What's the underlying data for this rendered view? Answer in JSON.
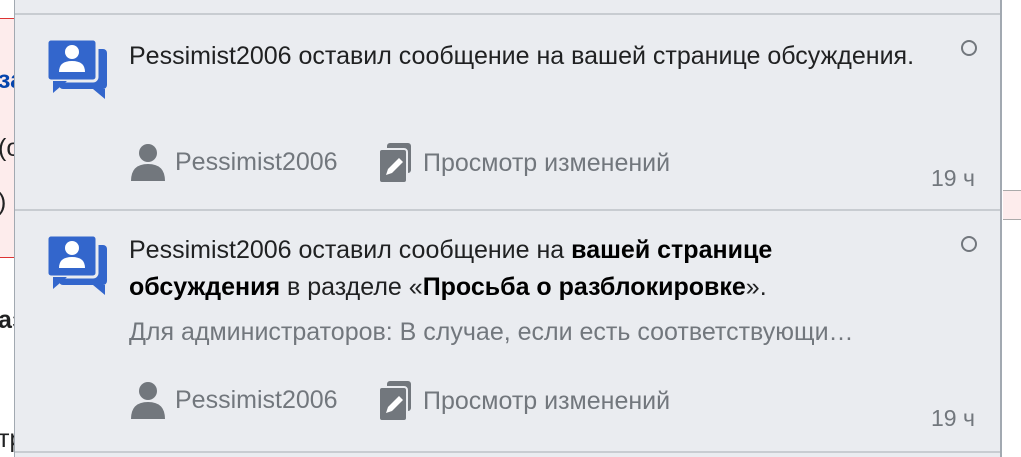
{
  "background": {
    "fragments": [
      "за",
      "(о",
      ")",
      "аз",
      "тр"
    ]
  },
  "notifications": [
    {
      "type_icon": "user-talk-icon",
      "text_plain": "Pessimist2006 оставил сообщение на вашей странице обсуждения.",
      "user_label": "Pessimist2006",
      "diff_label": "Просмотр изменений",
      "time": "19 ч"
    },
    {
      "type_icon": "user-talk-icon",
      "text_part1": "Pessimist2006 оставил сообщение на ",
      "text_bold1": "вашей странице обсуждения",
      "text_part2": " в разделе «",
      "text_bold2": "Просьба о разблокировке",
      "text_part3": "».",
      "snippet": "Для администраторов: В случае, если есть соответствующи…",
      "user_label": "Pessimist2006",
      "diff_label": "Просмотр изменений",
      "time": "19 ч"
    }
  ],
  "colors": {
    "accent_blue": "#3366cc",
    "muted_gray": "#72777d",
    "panel_bg": "#eaecf0"
  }
}
